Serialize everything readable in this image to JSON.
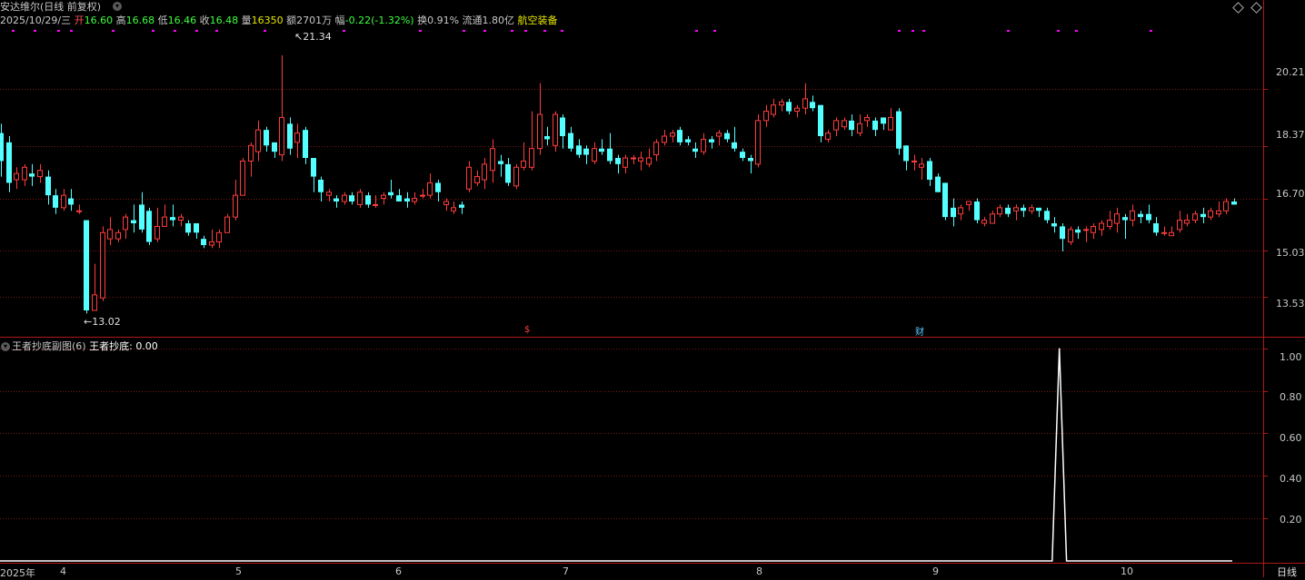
{
  "header": {
    "stock_title": "安达维尔(日线 前复权)",
    "date": "2025/10/29/三",
    "open_label": "开",
    "open_value": "16.60",
    "high_label": "高",
    "high_value": "16.68",
    "low_label": "低",
    "low_value": "16.46",
    "close_label": "收",
    "close_value": "16.48",
    "volume_label": "量",
    "volume_value": "16350",
    "amount_label": "额",
    "amount_value": "2701万",
    "change_label": "幅",
    "change_value": "-0.22(-1.32%)",
    "turnover_label": "换",
    "turnover_value": "0.91%",
    "float_label": "流通",
    "float_value": "1.80亿",
    "sector": "航空装备"
  },
  "sub_header": {
    "indicator_title": "王者抄底副图(6)",
    "indicator_name": "王者抄底:",
    "indicator_value": "0.00"
  },
  "price_axis": [
    "20.21",
    "18.37",
    "16.70",
    "15.03",
    "13.53"
  ],
  "indicator_axis": [
    "1.00",
    "0.80",
    "0.60",
    "0.40",
    "0.20"
  ],
  "time_axis": [
    "2025年",
    "4",
    "5",
    "6",
    "7",
    "8",
    "9",
    "10"
  ],
  "period_button": "日线",
  "annotations": {
    "high_mark": "21.34",
    "low_mark": "13.02"
  },
  "event_markers": {
    "dividend_mark": "$",
    "finance_mark": "财"
  },
  "colors": {
    "up": "#ff3c3c",
    "down": "#54ffff",
    "grid": "#7a1414",
    "axis": "#b01818",
    "indicator": "#ffffff",
    "top_dot": "#ff00ff"
  },
  "chart_data": {
    "type": "candlestick",
    "price_range": [
      12.4,
      22.2
    ],
    "indicator_range": [
      0,
      1.05
    ],
    "candles": [
      [
        18.8,
        17.9,
        19.1,
        17.4
      ],
      [
        18.5,
        17.2,
        18.7,
        16.9
      ],
      [
        17.3,
        17.5,
        17.7,
        17.0
      ],
      [
        17.3,
        17.7,
        17.8,
        17.1
      ],
      [
        17.5,
        17.4,
        17.8,
        17.1
      ],
      [
        17.4,
        17.6,
        17.8,
        17.2
      ],
      [
        17.4,
        16.8,
        17.6,
        16.5
      ],
      [
        16.8,
        16.4,
        17.0,
        16.2
      ],
      [
        16.4,
        16.8,
        17.0,
        16.3
      ],
      [
        16.7,
        16.5,
        17.0,
        16.3
      ],
      [
        16.3,
        16.3,
        16.5,
        16.2
      ],
      [
        16.0,
        13.1,
        16.0,
        13.0
      ],
      [
        13.1,
        13.6,
        14.6,
        13.1
      ],
      [
        13.5,
        15.6,
        15.8,
        13.4
      ],
      [
        15.4,
        15.7,
        16.1,
        15.2
      ],
      [
        15.4,
        15.6,
        15.7,
        15.3
      ],
      [
        15.7,
        16.1,
        16.2,
        15.4
      ],
      [
        16.0,
        15.9,
        16.5,
        15.6
      ],
      [
        16.5,
        15.7,
        16.9,
        15.6
      ],
      [
        16.3,
        15.3,
        16.4,
        15.2
      ],
      [
        15.4,
        15.8,
        16.4,
        15.3
      ],
      [
        15.8,
        16.1,
        16.5,
        15.8
      ],
      [
        16.1,
        16.0,
        16.5,
        15.8
      ],
      [
        16.0,
        16.1,
        16.2,
        15.8
      ],
      [
        15.9,
        15.6,
        16.0,
        15.5
      ],
      [
        15.9,
        15.6,
        15.9,
        15.4
      ],
      [
        15.4,
        15.2,
        15.5,
        15.1
      ],
      [
        15.2,
        15.3,
        15.7,
        15.1
      ],
      [
        15.3,
        15.6,
        15.7,
        15.1
      ],
      [
        15.6,
        16.1,
        16.2,
        15.6
      ],
      [
        16.1,
        16.8,
        17.3,
        16.0
      ],
      [
        16.8,
        17.9,
        18.0,
        16.8
      ],
      [
        17.9,
        18.4,
        18.5,
        17.4
      ],
      [
        18.2,
        18.9,
        19.2,
        17.9
      ],
      [
        18.9,
        18.4,
        19.0,
        18.2
      ],
      [
        18.5,
        18.2,
        18.5,
        18.0
      ],
      [
        18.1,
        19.3,
        21.3,
        17.9
      ],
      [
        19.1,
        18.3,
        19.3,
        18.1
      ],
      [
        18.5,
        18.8,
        19.1,
        18.0
      ],
      [
        18.9,
        18.0,
        19.0,
        17.8
      ],
      [
        18.0,
        17.4,
        18.0,
        16.9
      ],
      [
        17.3,
        16.9,
        17.4,
        16.6
      ],
      [
        16.8,
        16.9,
        17.0,
        16.6
      ],
      [
        16.7,
        16.6,
        16.8,
        16.4
      ],
      [
        16.6,
        16.8,
        16.9,
        16.5
      ],
      [
        16.8,
        16.6,
        16.9,
        16.5
      ],
      [
        16.5,
        16.9,
        17.0,
        16.4
      ],
      [
        16.8,
        16.5,
        16.9,
        16.4
      ],
      [
        16.5,
        16.5,
        16.8,
        16.4
      ],
      [
        16.7,
        16.8,
        16.9,
        16.5
      ],
      [
        16.9,
        16.8,
        17.3,
        16.7
      ],
      [
        16.8,
        16.6,
        17.0,
        16.6
      ],
      [
        16.7,
        16.6,
        16.9,
        16.4
      ],
      [
        16.6,
        16.7,
        16.9,
        16.5
      ],
      [
        16.8,
        16.8,
        17.0,
        16.7
      ],
      [
        16.8,
        17.2,
        17.5,
        16.7
      ],
      [
        17.2,
        16.9,
        17.3,
        16.6
      ],
      [
        16.5,
        16.6,
        16.7,
        16.3
      ],
      [
        16.3,
        16.4,
        16.6,
        16.2
      ],
      [
        16.5,
        16.4,
        16.6,
        16.2
      ],
      [
        17.0,
        17.7,
        17.9,
        16.9
      ],
      [
        17.2,
        17.4,
        17.6,
        17.1
      ],
      [
        17.3,
        17.8,
        18.0,
        17.0
      ],
      [
        17.6,
        18.3,
        18.6,
        17.2
      ],
      [
        17.9,
        17.8,
        18.1,
        17.4
      ],
      [
        17.8,
        17.2,
        18.0,
        17.1
      ],
      [
        17.1,
        17.7,
        17.8,
        17.0
      ],
      [
        17.7,
        17.9,
        18.5,
        17.6
      ],
      [
        17.7,
        18.3,
        19.5,
        17.6
      ],
      [
        18.3,
        19.4,
        20.4,
        18.1
      ],
      [
        18.7,
        18.6,
        19.0,
        18.4
      ],
      [
        18.4,
        19.4,
        19.5,
        18.2
      ],
      [
        19.3,
        18.7,
        19.4,
        18.3
      ],
      [
        18.8,
        18.3,
        19.0,
        18.2
      ],
      [
        18.4,
        18.1,
        18.6,
        18.0
      ],
      [
        18.3,
        18.1,
        18.4,
        17.8
      ],
      [
        17.9,
        18.3,
        18.5,
        17.8
      ],
      [
        18.3,
        18.2,
        18.6,
        18.1
      ],
      [
        18.3,
        17.9,
        18.8,
        17.8
      ],
      [
        18.0,
        17.8,
        18.1,
        17.5
      ],
      [
        17.7,
        18.0,
        18.1,
        17.5
      ],
      [
        18.0,
        18.0,
        18.1,
        17.8
      ],
      [
        17.9,
        18.0,
        18.2,
        17.6
      ],
      [
        17.8,
        18.0,
        18.3,
        17.7
      ],
      [
        18.1,
        18.5,
        18.6,
        17.9
      ],
      [
        18.5,
        18.7,
        18.9,
        18.4
      ],
      [
        18.7,
        18.8,
        18.9,
        18.5
      ],
      [
        18.9,
        18.5,
        19.0,
        18.4
      ],
      [
        18.6,
        18.5,
        18.7,
        18.4
      ],
      [
        18.3,
        18.2,
        18.5,
        18.0
      ],
      [
        18.2,
        18.6,
        18.8,
        18.1
      ],
      [
        18.6,
        18.5,
        18.7,
        18.3
      ],
      [
        18.7,
        18.8,
        18.9,
        18.4
      ],
      [
        18.8,
        18.6,
        18.9,
        18.5
      ],
      [
        18.5,
        18.3,
        19.0,
        18.2
      ],
      [
        18.2,
        18.0,
        18.3,
        17.9
      ],
      [
        18.0,
        17.9,
        18.1,
        17.5
      ],
      [
        17.8,
        19.2,
        19.4,
        17.7
      ],
      [
        19.2,
        19.5,
        19.7,
        19.0
      ],
      [
        19.4,
        19.7,
        19.9,
        19.3
      ],
      [
        19.7,
        19.8,
        19.9,
        19.5
      ],
      [
        19.8,
        19.5,
        19.9,
        19.4
      ],
      [
        19.5,
        19.6,
        19.7,
        19.3
      ],
      [
        19.6,
        19.9,
        20.4,
        19.4
      ],
      [
        19.8,
        19.6,
        20.0,
        19.5
      ],
      [
        19.7,
        18.7,
        19.7,
        18.5
      ],
      [
        18.6,
        18.8,
        18.9,
        18.5
      ],
      [
        18.9,
        19.2,
        19.3,
        18.7
      ],
      [
        19.0,
        19.2,
        19.3,
        18.9
      ],
      [
        19.2,
        18.9,
        19.4,
        18.7
      ],
      [
        18.8,
        19.1,
        19.4,
        18.7
      ],
      [
        19.2,
        19.3,
        19.4,
        19.0
      ],
      [
        19.2,
        18.9,
        19.3,
        18.7
      ],
      [
        19.3,
        19.1,
        19.3,
        18.9
      ],
      [
        18.9,
        19.3,
        19.6,
        18.9
      ],
      [
        19.5,
        18.3,
        19.6,
        18.1
      ],
      [
        18.4,
        17.9,
        18.4,
        17.6
      ],
      [
        17.9,
        17.9,
        18.1,
        17.6
      ],
      [
        17.7,
        17.8,
        18.0,
        17.3
      ],
      [
        17.9,
        17.3,
        18.0,
        17.1
      ],
      [
        17.4,
        16.9,
        17.5,
        16.9
      ],
      [
        17.2,
        16.1,
        17.2,
        16.0
      ],
      [
        16.4,
        16.1,
        16.7,
        15.8
      ],
      [
        16.2,
        16.4,
        16.5,
        16.0
      ],
      [
        16.5,
        16.6,
        16.6,
        16.3
      ],
      [
        16.6,
        16.0,
        16.7,
        15.9
      ],
      [
        15.9,
        16.0,
        16.1,
        15.8
      ],
      [
        15.9,
        16.2,
        16.3,
        15.9
      ],
      [
        16.2,
        16.4,
        16.5,
        16.1
      ],
      [
        16.4,
        16.2,
        16.5,
        16.1
      ],
      [
        16.3,
        16.4,
        16.5,
        16.0
      ],
      [
        16.4,
        16.3,
        16.5,
        16.1
      ],
      [
        16.3,
        16.4,
        16.5,
        16.2
      ],
      [
        16.4,
        16.3,
        16.4,
        16.1
      ],
      [
        16.3,
        16.0,
        16.4,
        15.9
      ],
      [
        15.9,
        15.8,
        16.1,
        15.6
      ],
      [
        15.8,
        15.4,
        15.9,
        15.0
      ],
      [
        15.3,
        15.7,
        15.8,
        15.2
      ],
      [
        15.7,
        15.6,
        15.8,
        15.4
      ],
      [
        15.7,
        15.7,
        15.8,
        15.3
      ],
      [
        15.6,
        15.8,
        15.9,
        15.4
      ],
      [
        15.7,
        15.9,
        16.0,
        15.5
      ],
      [
        15.8,
        16.0,
        16.3,
        15.7
      ],
      [
        15.9,
        16.2,
        16.4,
        15.6
      ],
      [
        16.1,
        16.0,
        16.2,
        15.4
      ],
      [
        16.0,
        16.3,
        16.5,
        15.8
      ],
      [
        16.2,
        16.1,
        16.3,
        15.9
      ],
      [
        16.2,
        16.0,
        16.5,
        15.9
      ],
      [
        15.9,
        15.6,
        16.1,
        15.5
      ],
      [
        15.6,
        15.6,
        15.8,
        15.5
      ],
      [
        15.5,
        15.6,
        15.8,
        15.5
      ],
      [
        15.7,
        16.0,
        16.3,
        15.6
      ],
      [
        15.9,
        16.0,
        16.2,
        15.8
      ],
      [
        16.0,
        16.2,
        16.3,
        15.9
      ],
      [
        16.2,
        16.1,
        16.4,
        15.9
      ],
      [
        16.1,
        16.3,
        16.4,
        16.0
      ],
      [
        16.2,
        16.3,
        16.6,
        16.1
      ],
      [
        16.3,
        16.6,
        16.7,
        16.2
      ],
      [
        16.6,
        16.5,
        16.7,
        16.5
      ]
    ],
    "indicator": {
      "type": "line",
      "values": [
        0,
        0,
        0,
        0,
        0,
        0,
        0,
        0,
        0,
        0,
        0,
        0,
        0,
        0,
        0,
        0,
        0,
        0,
        0,
        0,
        0,
        0,
        0,
        0,
        0,
        0,
        0,
        0,
        0,
        0,
        0,
        0,
        0,
        0,
        0,
        0,
        0,
        0,
        0,
        0,
        0,
        0,
        0,
        0,
        0,
        0,
        0,
        0,
        0,
        0,
        0,
        0,
        0,
        0,
        0,
        0,
        0,
        0,
        0,
        0,
        0,
        0,
        0,
        0,
        0,
        0,
        0,
        0,
        0,
        0,
        0,
        0,
        0,
        0,
        0,
        0,
        0,
        0,
        0,
        0,
        0,
        0,
        0,
        0,
        0,
        0,
        0,
        0,
        0,
        0,
        0,
        0,
        0,
        0,
        0,
        0,
        0,
        0,
        0,
        0,
        0,
        0,
        0,
        0,
        0,
        0,
        0,
        0,
        0,
        0,
        0,
        0,
        0,
        0,
        0,
        0,
        0,
        0,
        0,
        0,
        0,
        0,
        0,
        0,
        0,
        0,
        0,
        0,
        0,
        0,
        0,
        0,
        0,
        0,
        0,
        0,
        0,
        0,
        0,
        0,
        0,
        0,
        0,
        0,
        0,
        0,
        0,
        1,
        0,
        0,
        0,
        0,
        0,
        0,
        0,
        0,
        0,
        0,
        0,
        0,
        0,
        0,
        0,
        0,
        0,
        0,
        0,
        0,
        0,
        0,
        0,
        0
      ]
    }
  }
}
